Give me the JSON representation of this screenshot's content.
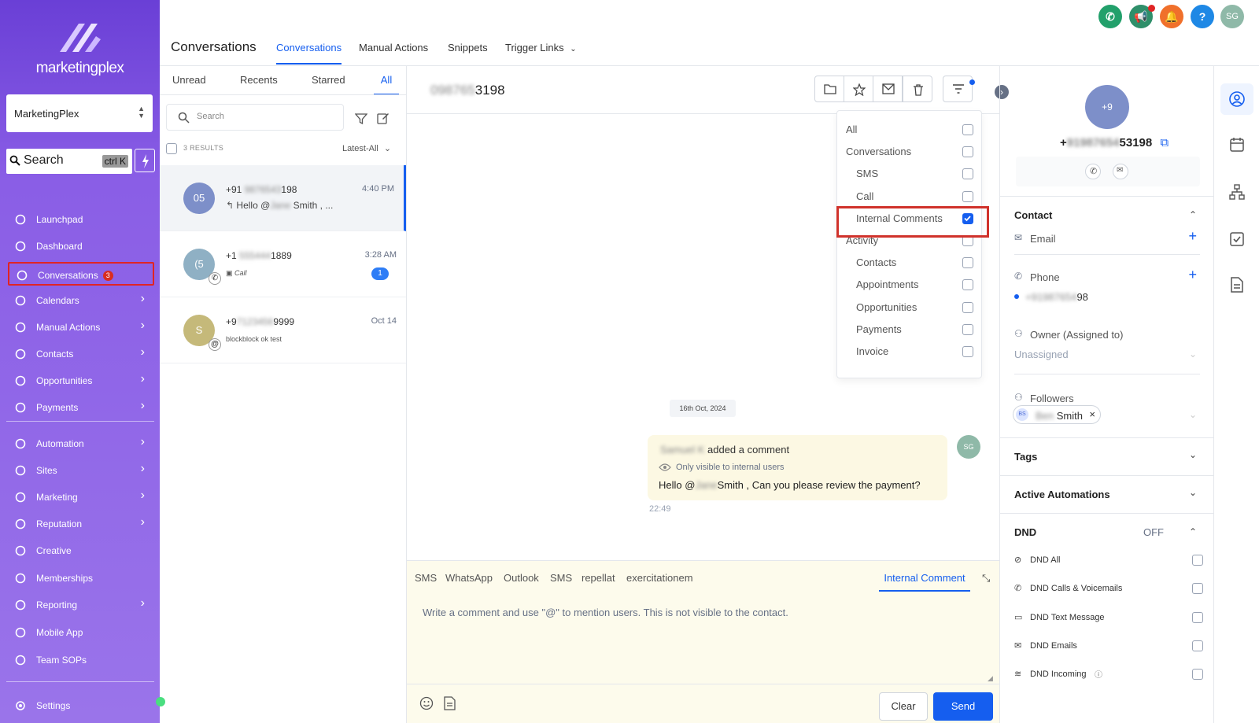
{
  "sidebar": {
    "brand": "marketingplex",
    "account": "MarketingPlex",
    "search": {
      "label": "Search",
      "shortcut": "ctrl K"
    },
    "items": [
      {
        "label": "Launchpad",
        "icon": "rocket-icon",
        "chevron": false
      },
      {
        "label": "Dashboard",
        "icon": "dashboard-icon",
        "chevron": false
      },
      {
        "label": "Conversations",
        "icon": "chat-icon",
        "chevron": false,
        "badge": "3",
        "active": true
      },
      {
        "label": "Calendars",
        "icon": "calendar-icon",
        "chevron": true
      },
      {
        "label": "Manual Actions",
        "icon": "check-circle-icon",
        "chevron": true
      },
      {
        "label": "Contacts",
        "icon": "contacts-icon",
        "chevron": true
      },
      {
        "label": "Opportunities",
        "icon": "funnel-icon",
        "chevron": true
      },
      {
        "label": "Payments",
        "icon": "card-icon",
        "chevron": true
      },
      {
        "label": "Automation",
        "icon": "automation-icon",
        "chevron": true
      },
      {
        "label": "Sites",
        "icon": "globe-icon",
        "chevron": true
      },
      {
        "label": "Marketing",
        "icon": "send-icon",
        "chevron": true
      },
      {
        "label": "Reputation",
        "icon": "star-icon",
        "chevron": true
      },
      {
        "label": "Creative",
        "icon": "palette-icon",
        "chevron": false
      },
      {
        "label": "Memberships",
        "icon": "award-icon",
        "chevron": false
      },
      {
        "label": "Reporting",
        "icon": "chart-icon",
        "chevron": true
      },
      {
        "label": "Mobile App",
        "icon": "mobile-icon",
        "chevron": false
      },
      {
        "label": "Team SOPs",
        "icon": "list-icon",
        "chevron": false
      }
    ],
    "settings": "Settings"
  },
  "header": {
    "title": "Conversations",
    "tabs": [
      "Conversations",
      "Manual Actions",
      "Snippets",
      "Trigger Links"
    ],
    "user_initials": "SG"
  },
  "list": {
    "tabs": [
      "Unread",
      "Recents",
      "Starred",
      "All"
    ],
    "search_placeholder": "Search",
    "results": "3 RESULTS",
    "sort": "Latest-All",
    "conversations": [
      {
        "initials": "05",
        "name_prefix": "+91",
        "name_hidden": "9876543",
        "name_suffix": "198",
        "time": "4:40 PM",
        "preview_prefix": "Hello @",
        "preview_hidden": "Jane",
        "preview_suffix": "Smith , ...",
        "avatar_color": "#7d8fc9"
      },
      {
        "initials": "(5",
        "name_prefix": "+1",
        "name_hidden": "555444",
        "name_suffix": "1889",
        "time": "3:28 AM",
        "preview": "Call",
        "unread": "1",
        "avatar_color": "#8fb0c4"
      },
      {
        "initials": "S",
        "name_prefix": "+9",
        "name_hidden": "7123456",
        "name_suffix": "9999",
        "time": "Oct 14",
        "preview": "blockblock ok test",
        "avatar_color": "#c5b97a"
      }
    ]
  },
  "chat": {
    "contact_prefix": "",
    "contact_hidden": "098765",
    "contact_suffix": "3198",
    "filter_menu": [
      {
        "label": "All",
        "checked": false,
        "indent": false
      },
      {
        "label": "Conversations",
        "checked": false,
        "indent": false
      },
      {
        "label": "SMS",
        "checked": false,
        "indent": true
      },
      {
        "label": "Call",
        "checked": false,
        "indent": true
      },
      {
        "label": "Internal Comments",
        "checked": true,
        "indent": true
      },
      {
        "label": "Activity",
        "checked": false,
        "indent": false
      },
      {
        "label": "Contacts",
        "checked": false,
        "indent": true
      },
      {
        "label": "Appointments",
        "checked": false,
        "indent": true
      },
      {
        "label": "Opportunities",
        "checked": false,
        "indent": true
      },
      {
        "label": "Payments",
        "checked": false,
        "indent": true
      },
      {
        "label": "Invoice",
        "checked": false,
        "indent": true
      }
    ],
    "date_divider": "16th Oct, 2024",
    "message": {
      "author_hidden": "Samuel K",
      "action": "added a comment",
      "visibility": "Only visible to internal users",
      "body_prefix": "Hello @",
      "body_hidden": "Jane",
      "body_suffix": "Smith  , Can you please review the payment?",
      "time": "22:49",
      "avatar": "SG"
    },
    "composer": {
      "tabs": [
        "SMS",
        "WhatsApp",
        "Outlook",
        "SMS",
        "repellat",
        "exercitationem"
      ],
      "active_tab": "Internal Comment",
      "placeholder": "Write a comment and use \"@\" to mention users. This is not visible to the contact.",
      "clear": "Clear",
      "send": "Send"
    }
  },
  "contact_panel": {
    "avatar": "+9",
    "number_prefix": "+",
    "number_hidden": "91987654",
    "number_suffix": "53198",
    "contact_header": "Contact",
    "email_label": "Email",
    "phone_label": "Phone",
    "phone_hidden": "+91987654",
    "phone_suffix": "98",
    "owner_label": "Owner (Assigned to)",
    "owner_value": "Unassigned",
    "followers_label": "Followers",
    "follower_initials": "BS",
    "follower_hidden": "Ben",
    "follower_suffix": "Smith",
    "tags": "Tags",
    "automations": "Active Automations",
    "dnd": "DND",
    "dnd_state": "OFF",
    "dnd_items": [
      "DND All",
      "DND Calls & Voicemails",
      "DND Text Message",
      "DND Emails",
      "DND Incoming"
    ]
  },
  "colors": {
    "accent": "#155eef",
    "highlight": "#d0322b",
    "sidebar": "#7b4fe0"
  }
}
